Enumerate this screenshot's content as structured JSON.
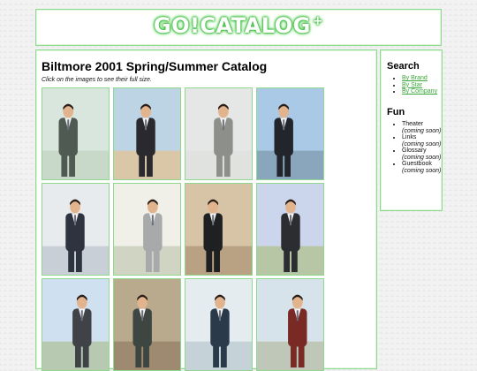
{
  "header": {
    "logo_text": "GO!CATALOG",
    "logo_plus": "+"
  },
  "main": {
    "title": "Biltmore 2001 Spring/Summer Catalog",
    "subtitle": "Click on the images to see their full size."
  },
  "sidebar": {
    "search": {
      "heading": "Search",
      "links": [
        {
          "label": "By Brand"
        },
        {
          "label": "By Star"
        },
        {
          "label": "By Company"
        }
      ]
    },
    "fun": {
      "heading": "Fun",
      "items": [
        {
          "label": "Theater",
          "note": "(coming soon)"
        },
        {
          "label": "Links",
          "note": "(coming soon)"
        },
        {
          "label": "Glossary",
          "note": "(coming soon)"
        },
        {
          "label": "Guestbook",
          "note": "(coming soon)"
        }
      ]
    }
  },
  "gallery": {
    "images": [
      {
        "name": "catalog-photo-1",
        "suit": "#4e5a52",
        "bg": "#d9e6dd",
        "ground": "#c9d9c9"
      },
      {
        "name": "catalog-photo-2",
        "suit": "#2a2a2e",
        "bg": "#bcd4e4",
        "ground": "#d9c7a8"
      },
      {
        "name": "catalog-photo-3",
        "suit": "#8c8f8a",
        "bg": "#e5e7e6",
        "ground": "#e0e2e0"
      },
      {
        "name": "catalog-photo-4",
        "suit": "#22252c",
        "bg": "#a9c9e6",
        "ground": "#8aa6bc"
      },
      {
        "name": "catalog-photo-5",
        "suit": "#2e3340",
        "bg": "#e8ebee",
        "ground": "#c9cfd6"
      },
      {
        "name": "catalog-photo-6",
        "suit": "#a7a9ab",
        "bg": "#f0efe8",
        "ground": "#cfd4c3"
      },
      {
        "name": "catalog-photo-7",
        "suit": "#1f2022",
        "bg": "#d7c3a6",
        "ground": "#b9a184"
      },
      {
        "name": "catalog-photo-8",
        "suit": "#2b2d31",
        "bg": "#cbd6ec",
        "ground": "#b7c6a5"
      },
      {
        "name": "catalog-photo-9",
        "suit": "#3f4347",
        "bg": "#cfe1f0",
        "ground": "#b7c9b0"
      },
      {
        "name": "catalog-photo-10",
        "suit": "#3d4640",
        "bg": "#b9a98d",
        "ground": "#9e8a70"
      },
      {
        "name": "catalog-photo-11",
        "suit": "#2a3a4a",
        "bg": "#e5ecef",
        "ground": "#c5d3d9"
      },
      {
        "name": "catalog-photo-12",
        "suit": "#7a2a25",
        "bg": "#d6e3ea",
        "ground": "#bfc7b8"
      }
    ]
  }
}
